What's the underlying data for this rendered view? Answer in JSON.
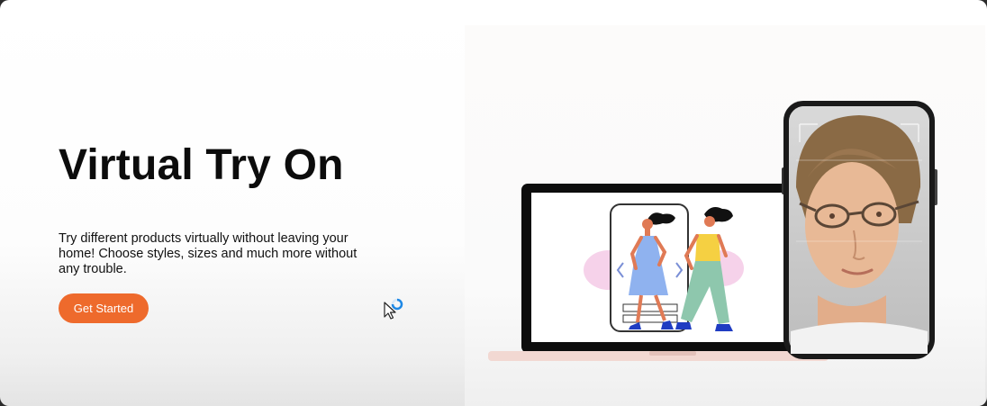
{
  "hero": {
    "title": "Virtual Try On",
    "description": "Try different products virtually without leaving your home! Choose styles, sizes and much more without any trouble.",
    "cta_label": "Get Started"
  },
  "icons": {
    "cursor": "pointer-cursor-icon",
    "busy": "loading-spinner-icon",
    "nav_left": "chevron-left-icon",
    "nav_right": "chevron-right-icon"
  },
  "colors": {
    "accent": "#ee6a2c",
    "title_text": "#0c0c0c",
    "body_text": "#111111",
    "spinner": "#1e88e5"
  }
}
